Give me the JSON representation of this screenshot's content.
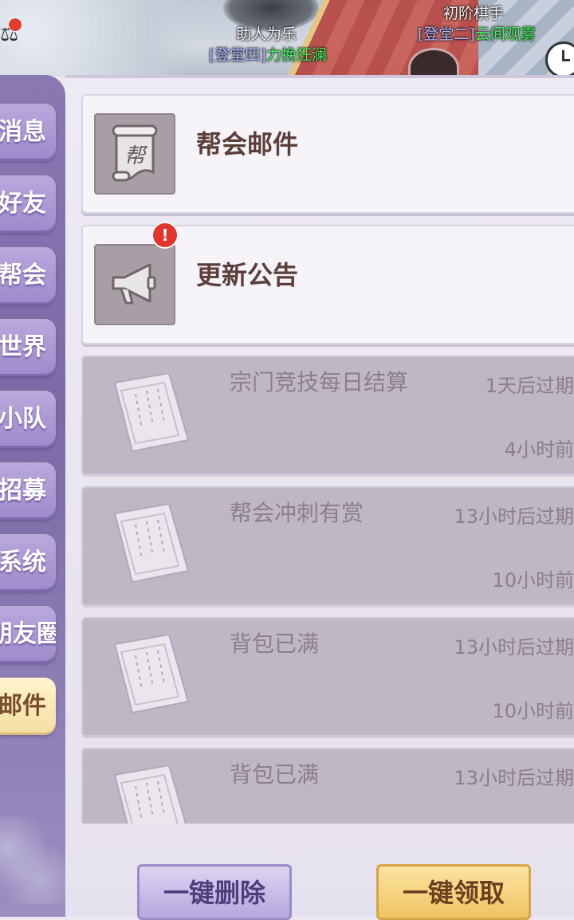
{
  "banner": {
    "players": [
      {
        "name": "助人为乐",
        "tag": "[登堂四]",
        "title": "力挽狂澜"
      },
      {
        "name": "初阶棋手",
        "tag": "[登堂二]",
        "title": "云间观雾"
      }
    ]
  },
  "sidebar": {
    "tabs": [
      {
        "label": "消息"
      },
      {
        "label": "好友"
      },
      {
        "label": "帮会"
      },
      {
        "label": "世界"
      },
      {
        "label": "小队"
      },
      {
        "label": "招募"
      },
      {
        "label": "系统"
      },
      {
        "label": "朋友圈"
      },
      {
        "label": "邮件",
        "active": true
      }
    ]
  },
  "categories": [
    {
      "title": "帮会邮件",
      "icon": "guild-scroll-icon",
      "icon_text": "帮"
    },
    {
      "title": "更新公告",
      "icon": "megaphone-icon",
      "badge": "!"
    }
  ],
  "mails": [
    {
      "title": "宗门竞技每日结算",
      "expire": "1天后过期",
      "time": "4小时前"
    },
    {
      "title": "帮会冲刺有赏",
      "expire": "13小时后过期",
      "time": "10小时前"
    },
    {
      "title": "背包已满",
      "expire": "13小时后过期",
      "time": "10小时前"
    },
    {
      "title": "背包已满",
      "expire": "13小时后过期",
      "time": ""
    }
  ],
  "buttons": {
    "delete_all": "一键删除",
    "claim_all": "一键领取"
  },
  "colors": {
    "sidebar": "#8a78b3",
    "active_tab": "#f3dea0",
    "read_mail_bg": "#bfb7c4",
    "badge_red": "#e2352c"
  }
}
